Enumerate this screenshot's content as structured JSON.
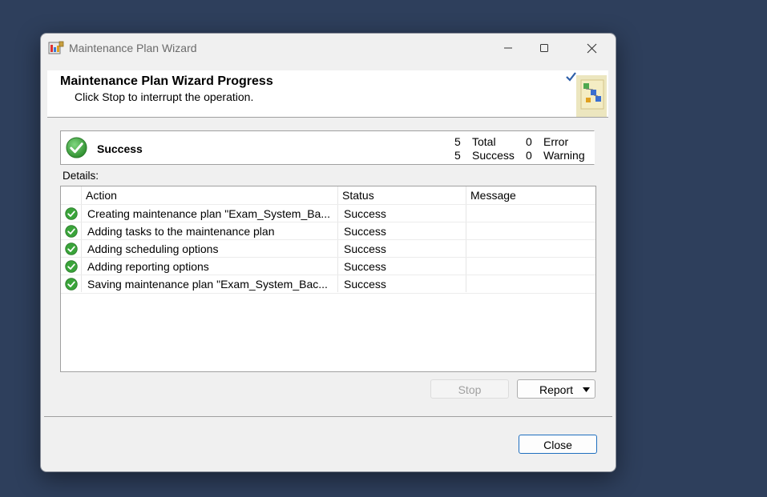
{
  "window": {
    "title": "Maintenance Plan Wizard"
  },
  "header": {
    "title": "Maintenance Plan Wizard Progress",
    "subtitle": "Click Stop to interrupt the operation."
  },
  "summary": {
    "status": "Success",
    "total_count": "5",
    "total_label": "Total",
    "success_count": "5",
    "success_label": "Success",
    "error_count": "0",
    "error_label": "Error",
    "warning_count": "0",
    "warning_label": "Warning"
  },
  "details": {
    "label": "Details:",
    "columns": [
      "Action",
      "Status",
      "Message"
    ],
    "rows": [
      {
        "action": "Creating maintenance plan \"Exam_System_Ba...",
        "status": "Success",
        "message": ""
      },
      {
        "action": "Adding tasks to the maintenance plan",
        "status": "Success",
        "message": ""
      },
      {
        "action": "Adding scheduling options",
        "status": "Success",
        "message": ""
      },
      {
        "action": "Adding reporting options",
        "status": "Success",
        "message": ""
      },
      {
        "action": "Saving maintenance plan \"Exam_System_Bac...",
        "status": "Success",
        "message": ""
      }
    ]
  },
  "buttons": {
    "stop": "Stop",
    "report": "Report",
    "close": "Close"
  },
  "colors": {
    "success_green": "#3aa43a",
    "accent_blue": "#1f6fbf",
    "desktop_bg": "#2e3f5c"
  }
}
